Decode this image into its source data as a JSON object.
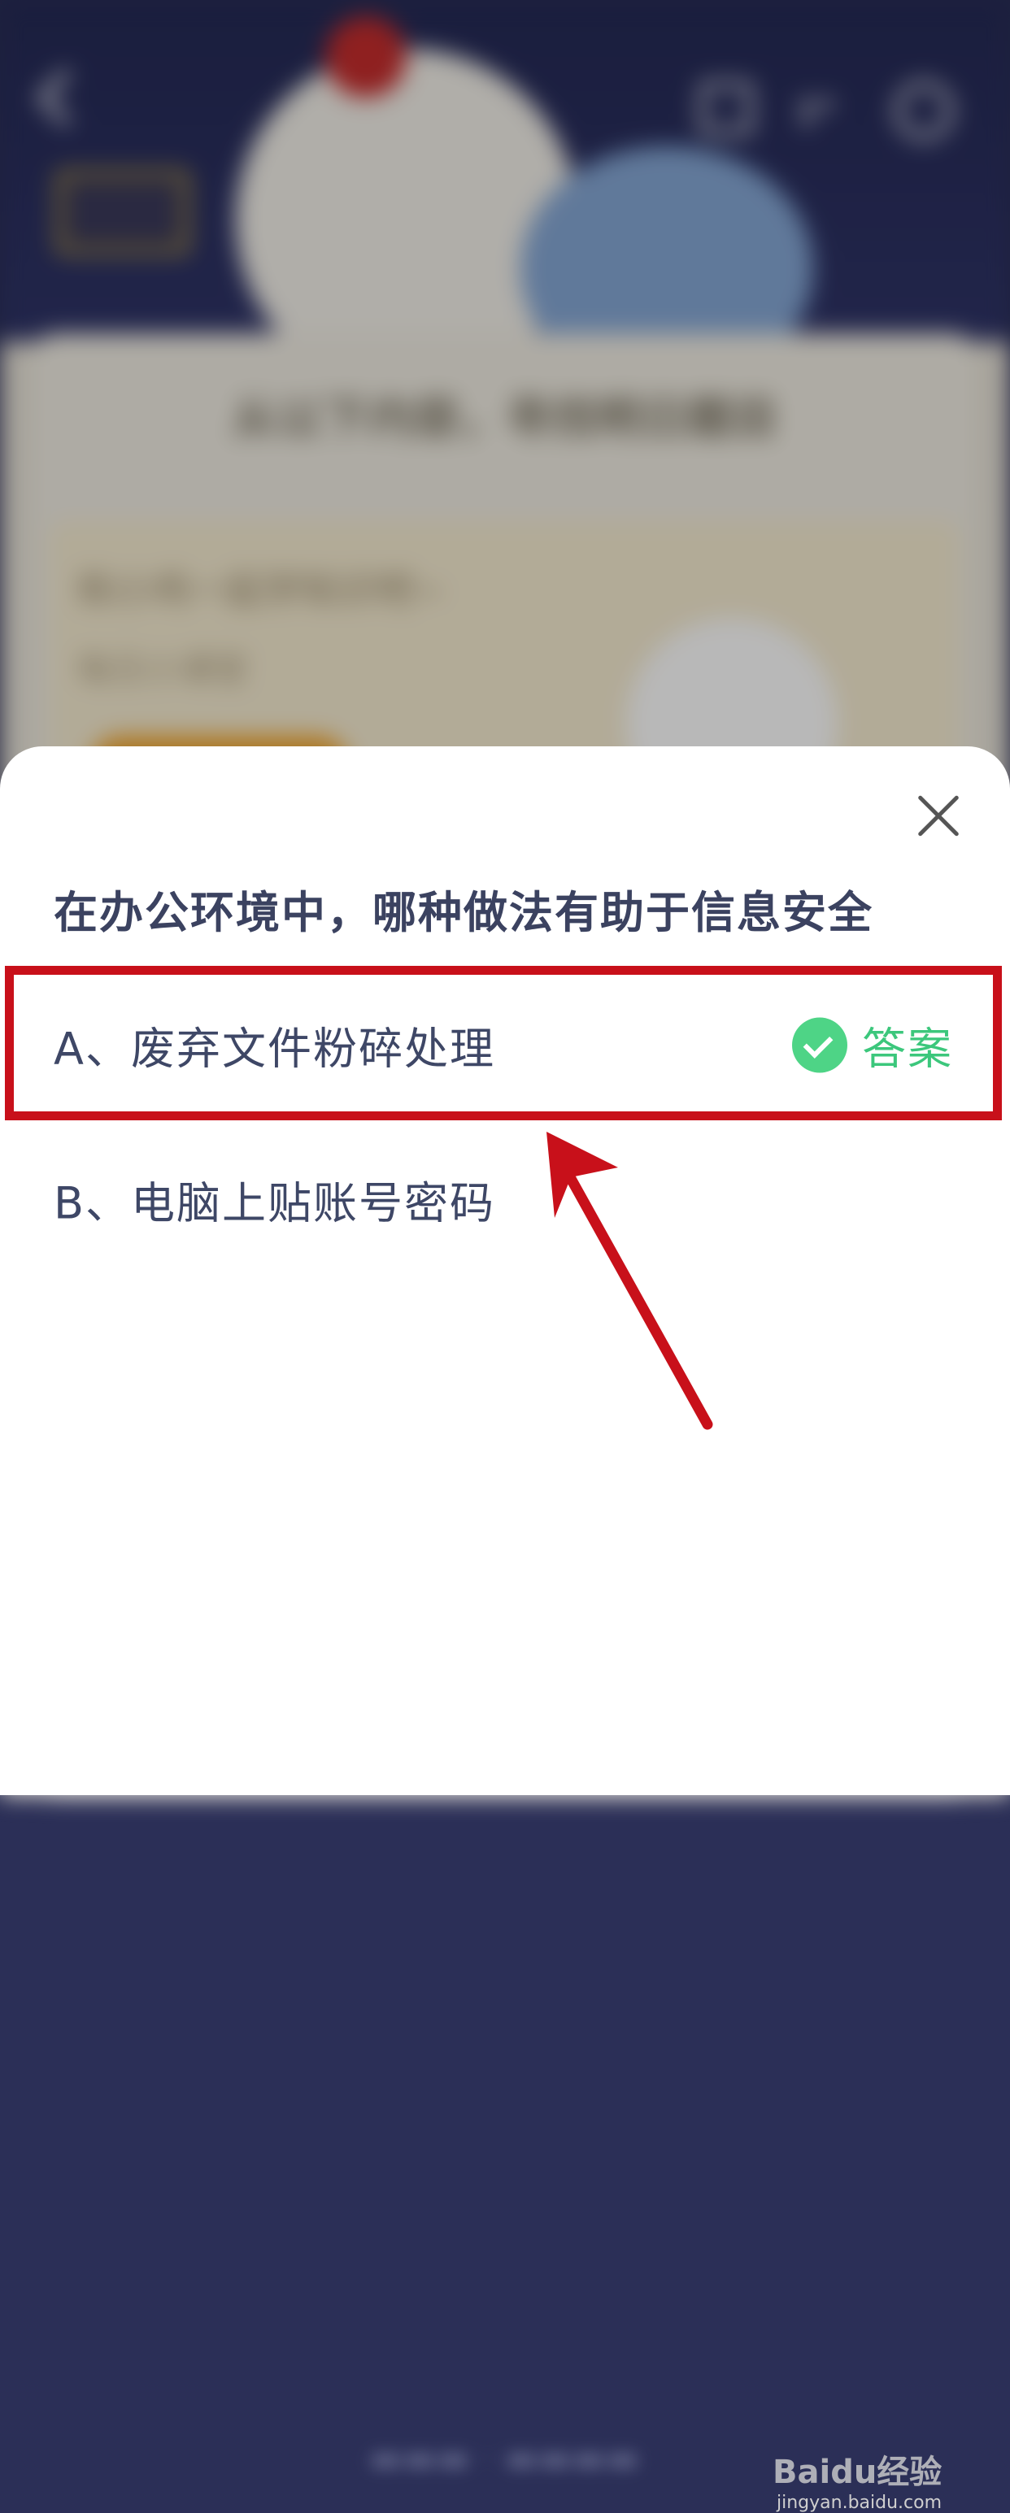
{
  "dialog": {
    "question": "在办公环境中，哪种做法有助于信息安全",
    "options": [
      {
        "label": "A、废弃文件粉碎处理",
        "is_answer": true,
        "answer_tag": "答案"
      },
      {
        "label": "B、电脑上贴账号密码",
        "is_answer": false
      }
    ]
  },
  "background": {
    "title": "从以下内容，寻找明日题目",
    "card_line1": "和小鸡一起学知识吧~",
    "card_line2": "每日小课堂"
  },
  "watermark": {
    "brand": "Baidu经验",
    "url": "jingyan.baidu.com"
  },
  "colors": {
    "highlight": "#c8101a",
    "answer_green": "#3cc77c",
    "check_circle": "#4ed486"
  }
}
